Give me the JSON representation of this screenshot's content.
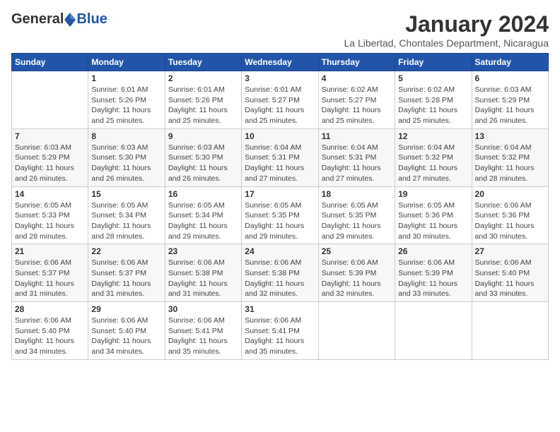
{
  "logo": {
    "general": "General",
    "blue": "Blue"
  },
  "title": "January 2024",
  "location": "La Libertad, Chontales Department, Nicaragua",
  "days_of_week": [
    "Sunday",
    "Monday",
    "Tuesday",
    "Wednesday",
    "Thursday",
    "Friday",
    "Saturday"
  ],
  "weeks": [
    [
      {
        "day": "",
        "info": ""
      },
      {
        "day": "1",
        "info": "Sunrise: 6:01 AM\nSunset: 5:26 PM\nDaylight: 11 hours\nand 25 minutes."
      },
      {
        "day": "2",
        "info": "Sunrise: 6:01 AM\nSunset: 5:26 PM\nDaylight: 11 hours\nand 25 minutes."
      },
      {
        "day": "3",
        "info": "Sunrise: 6:01 AM\nSunset: 5:27 PM\nDaylight: 11 hours\nand 25 minutes."
      },
      {
        "day": "4",
        "info": "Sunrise: 6:02 AM\nSunset: 5:27 PM\nDaylight: 11 hours\nand 25 minutes."
      },
      {
        "day": "5",
        "info": "Sunrise: 6:02 AM\nSunset: 5:28 PM\nDaylight: 11 hours\nand 25 minutes."
      },
      {
        "day": "6",
        "info": "Sunrise: 6:03 AM\nSunset: 5:29 PM\nDaylight: 11 hours\nand 26 minutes."
      }
    ],
    [
      {
        "day": "7",
        "info": "Sunrise: 6:03 AM\nSunset: 5:29 PM\nDaylight: 11 hours\nand 26 minutes."
      },
      {
        "day": "8",
        "info": "Sunrise: 6:03 AM\nSunset: 5:30 PM\nDaylight: 11 hours\nand 26 minutes."
      },
      {
        "day": "9",
        "info": "Sunrise: 6:03 AM\nSunset: 5:30 PM\nDaylight: 11 hours\nand 26 minutes."
      },
      {
        "day": "10",
        "info": "Sunrise: 6:04 AM\nSunset: 5:31 PM\nDaylight: 11 hours\nand 27 minutes."
      },
      {
        "day": "11",
        "info": "Sunrise: 6:04 AM\nSunset: 5:31 PM\nDaylight: 11 hours\nand 27 minutes."
      },
      {
        "day": "12",
        "info": "Sunrise: 6:04 AM\nSunset: 5:32 PM\nDaylight: 11 hours\nand 27 minutes."
      },
      {
        "day": "13",
        "info": "Sunrise: 6:04 AM\nSunset: 5:32 PM\nDaylight: 11 hours\nand 28 minutes."
      }
    ],
    [
      {
        "day": "14",
        "info": "Sunrise: 6:05 AM\nSunset: 5:33 PM\nDaylight: 11 hours\nand 28 minutes."
      },
      {
        "day": "15",
        "info": "Sunrise: 6:05 AM\nSunset: 5:34 PM\nDaylight: 11 hours\nand 28 minutes."
      },
      {
        "day": "16",
        "info": "Sunrise: 6:05 AM\nSunset: 5:34 PM\nDaylight: 11 hours\nand 29 minutes."
      },
      {
        "day": "17",
        "info": "Sunrise: 6:05 AM\nSunset: 5:35 PM\nDaylight: 11 hours\nand 29 minutes."
      },
      {
        "day": "18",
        "info": "Sunrise: 6:05 AM\nSunset: 5:35 PM\nDaylight: 11 hours\nand 29 minutes."
      },
      {
        "day": "19",
        "info": "Sunrise: 6:05 AM\nSunset: 5:36 PM\nDaylight: 11 hours\nand 30 minutes."
      },
      {
        "day": "20",
        "info": "Sunrise: 6:06 AM\nSunset: 5:36 PM\nDaylight: 11 hours\nand 30 minutes."
      }
    ],
    [
      {
        "day": "21",
        "info": "Sunrise: 6:06 AM\nSunset: 5:37 PM\nDaylight: 11 hours\nand 31 minutes."
      },
      {
        "day": "22",
        "info": "Sunrise: 6:06 AM\nSunset: 5:37 PM\nDaylight: 11 hours\nand 31 minutes."
      },
      {
        "day": "23",
        "info": "Sunrise: 6:06 AM\nSunset: 5:38 PM\nDaylight: 11 hours\nand 31 minutes."
      },
      {
        "day": "24",
        "info": "Sunrise: 6:06 AM\nSunset: 5:38 PM\nDaylight: 11 hours\nand 32 minutes."
      },
      {
        "day": "25",
        "info": "Sunrise: 6:06 AM\nSunset: 5:39 PM\nDaylight: 11 hours\nand 32 minutes."
      },
      {
        "day": "26",
        "info": "Sunrise: 6:06 AM\nSunset: 5:39 PM\nDaylight: 11 hours\nand 33 minutes."
      },
      {
        "day": "27",
        "info": "Sunrise: 6:06 AM\nSunset: 5:40 PM\nDaylight: 11 hours\nand 33 minutes."
      }
    ],
    [
      {
        "day": "28",
        "info": "Sunrise: 6:06 AM\nSunset: 5:40 PM\nDaylight: 11 hours\nand 34 minutes."
      },
      {
        "day": "29",
        "info": "Sunrise: 6:06 AM\nSunset: 5:40 PM\nDaylight: 11 hours\nand 34 minutes."
      },
      {
        "day": "30",
        "info": "Sunrise: 6:06 AM\nSunset: 5:41 PM\nDaylight: 11 hours\nand 35 minutes."
      },
      {
        "day": "31",
        "info": "Sunrise: 6:06 AM\nSunset: 5:41 PM\nDaylight: 11 hours\nand 35 minutes."
      },
      {
        "day": "",
        "info": ""
      },
      {
        "day": "",
        "info": ""
      },
      {
        "day": "",
        "info": ""
      }
    ]
  ]
}
